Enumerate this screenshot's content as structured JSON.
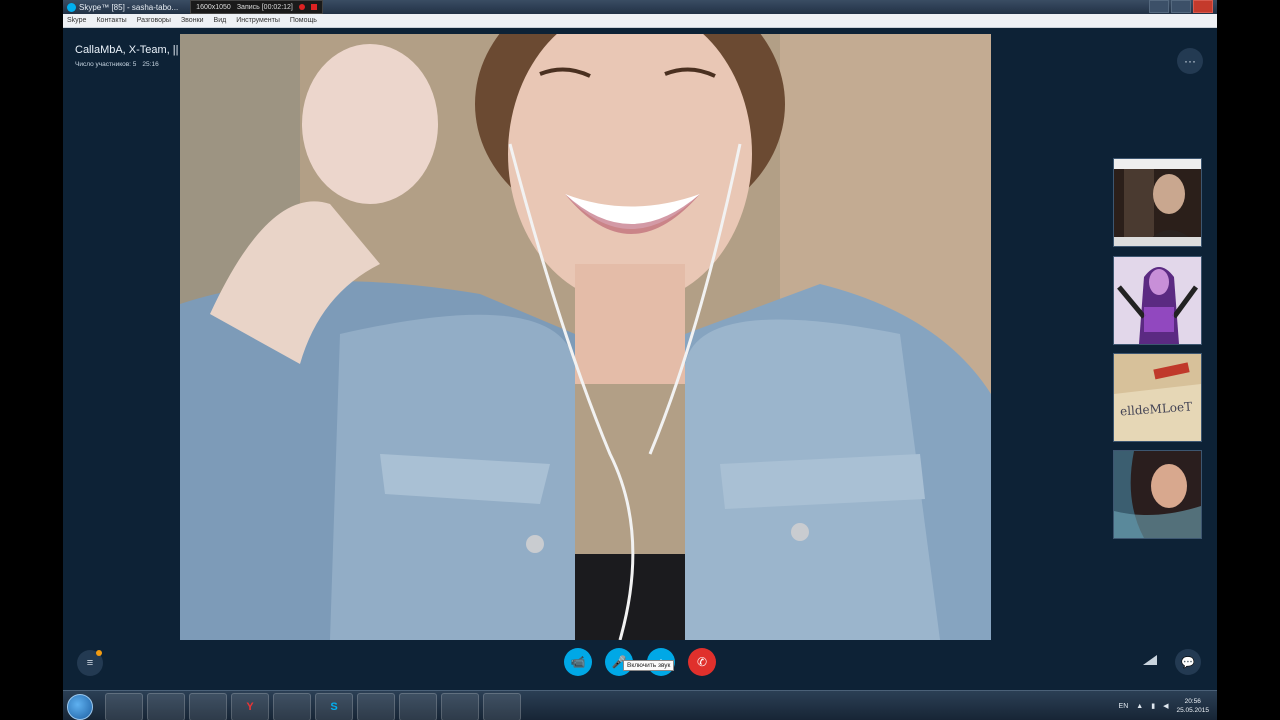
{
  "titlebar": {
    "app_title": "Skype™ [85] - sasha-tabo...",
    "resolution": "1600x1050",
    "recording_label": "Запись [00:02:12]"
  },
  "menu": [
    "Skype",
    "Контакты",
    "Разговоры",
    "Звонки",
    "Вид",
    "Инструменты",
    "Помощь"
  ],
  "call": {
    "title": "CallaMbA, X-Team, || Green Lantern || Mrochita",
    "participants": "Число участников: 5",
    "duration": "25:16"
  },
  "controls": {
    "more_glyph": "···",
    "video_glyph": "📹",
    "mic_glyph": "🎤",
    "add_glyph": "+",
    "end_glyph": "✆",
    "tooltip": "Включить звук",
    "chat_glyph": "💬",
    "left_glyph": "≡"
  },
  "thumbnails": {
    "t3_text": "elldeMLoeT"
  },
  "taskbar": {
    "skype_glyph": "S",
    "yandex_glyph": "Y",
    "lang": "EN",
    "time": "20:56",
    "date": "25.05.2015"
  },
  "colors": {
    "skype_blue": "#00a8e6",
    "end_call_red": "#e0302c",
    "window_bg": "#0d2236"
  }
}
